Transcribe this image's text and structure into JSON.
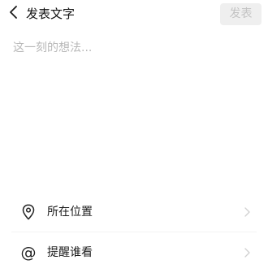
{
  "header": {
    "title": "发表文字",
    "back_icon": "chevron-left-icon",
    "publish_label": "发表"
  },
  "composer": {
    "placeholder": "这一刻的想法...",
    "value": ""
  },
  "options": [
    {
      "icon": "location-pin-icon",
      "label": "所在位置",
      "chevron_icon": "chevron-right-icon"
    },
    {
      "icon": "at-sign-icon",
      "label": "提醒谁看",
      "chevron_icon": "chevron-right-icon"
    }
  ],
  "colors": {
    "background": "#ffffff",
    "publish_button_bg": "#efefef",
    "publish_button_text": "#c3c3c3",
    "placeholder_text": "#b8b8b8",
    "chevron": "#d0d0d0"
  }
}
